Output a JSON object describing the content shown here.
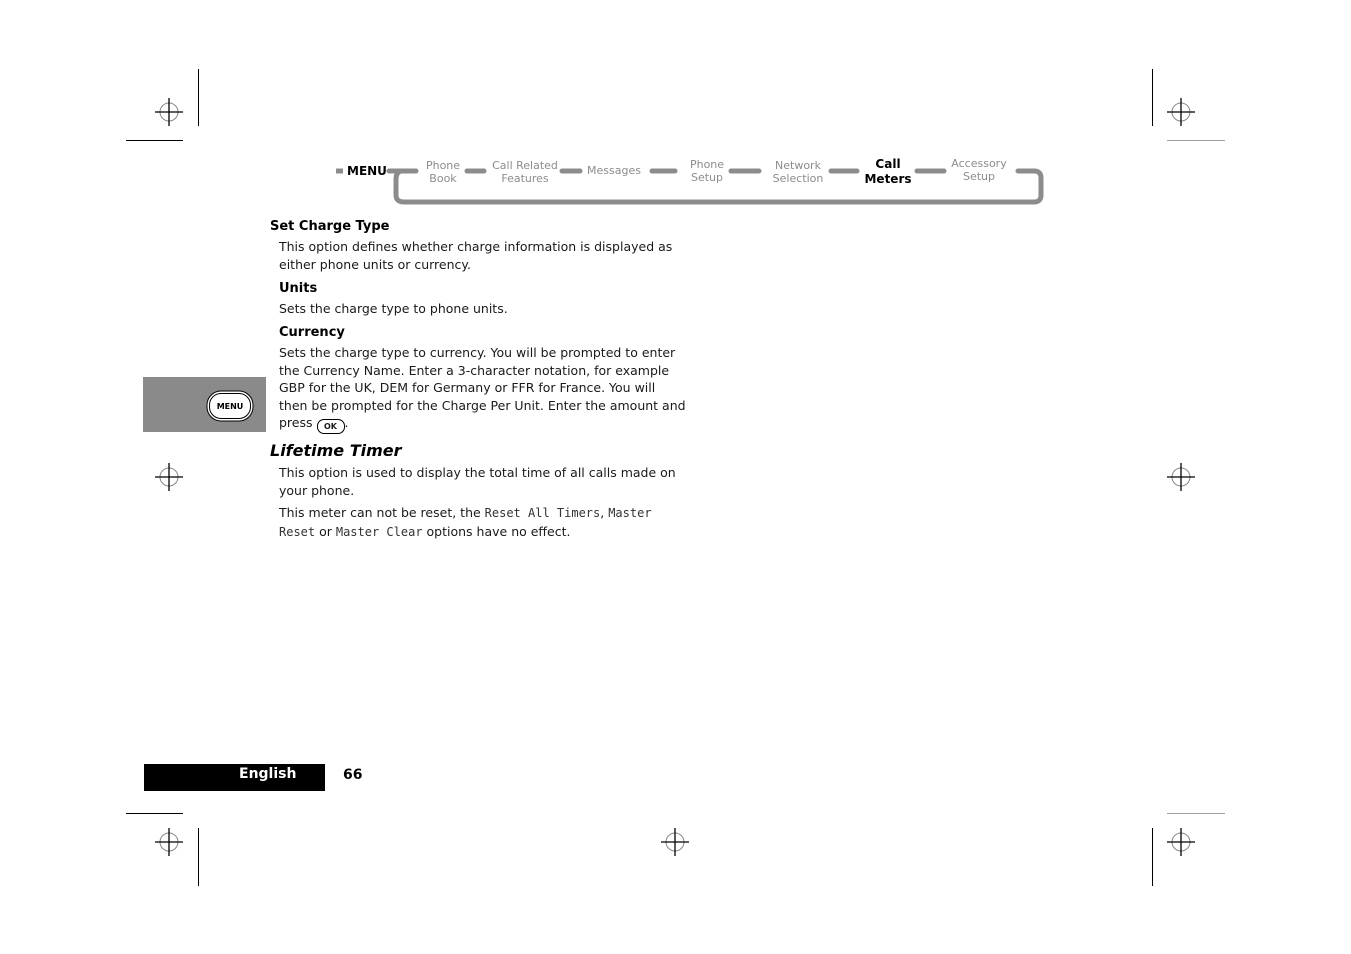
{
  "navigation": {
    "root_label": "MENU",
    "items": [
      {
        "line1": "Phone",
        "line2": "Book",
        "active": false
      },
      {
        "line1": "Call Related",
        "line2": "Features",
        "active": false
      },
      {
        "line1": "Messages",
        "line2": "",
        "active": false
      },
      {
        "line1": "Phone",
        "line2": "Setup",
        "active": false
      },
      {
        "line1": "Network",
        "line2": "Selection",
        "active": false
      },
      {
        "line1": "Call",
        "line2": "Meters",
        "active": true
      },
      {
        "line1": "Accessory",
        "line2": "Setup",
        "active": false
      }
    ],
    "colors": {
      "inactive_text": "#8c8c8c",
      "active_text": "#000000",
      "connector": "#8c8c8c"
    }
  },
  "side_tab": {
    "key_label": "MENU",
    "color": "#8a8a8a"
  },
  "content": {
    "set_charge_type": {
      "heading": "Set Charge Type",
      "description_line1": "This option defines whether charge information is displayed as",
      "description_line2": "either phone units or currency.",
      "units": {
        "heading": "Units",
        "text": "Sets the charge type to phone units."
      },
      "currency": {
        "heading": "Currency",
        "line1": "Sets the charge type to currency. You will be prompted to enter",
        "line2": "the Currency Name. Enter a 3-character notation, for example",
        "line3": "GBP for the UK, DEM for Germany or FFR for France. You will",
        "line4": "then be prompted for the Charge Per Unit. Enter the amount and",
        "line5_prefix": "press",
        "ok_key": "OK",
        "line5_suffix": "."
      }
    },
    "lifetime_timer": {
      "heading": "Lifetime Timer",
      "line1": "This option is used to display the total time of all calls made on",
      "line2": "your phone.",
      "note_prefix": "This meter can not be reset, the ",
      "option1": "Reset All Timers",
      "sep1": ", ",
      "option2a": "Master",
      "option2b": "Reset",
      "sep2": " or ",
      "option3": "Master Clear",
      "note_suffix": " options have no effect."
    }
  },
  "footer": {
    "language": "English",
    "page_number": "66"
  }
}
